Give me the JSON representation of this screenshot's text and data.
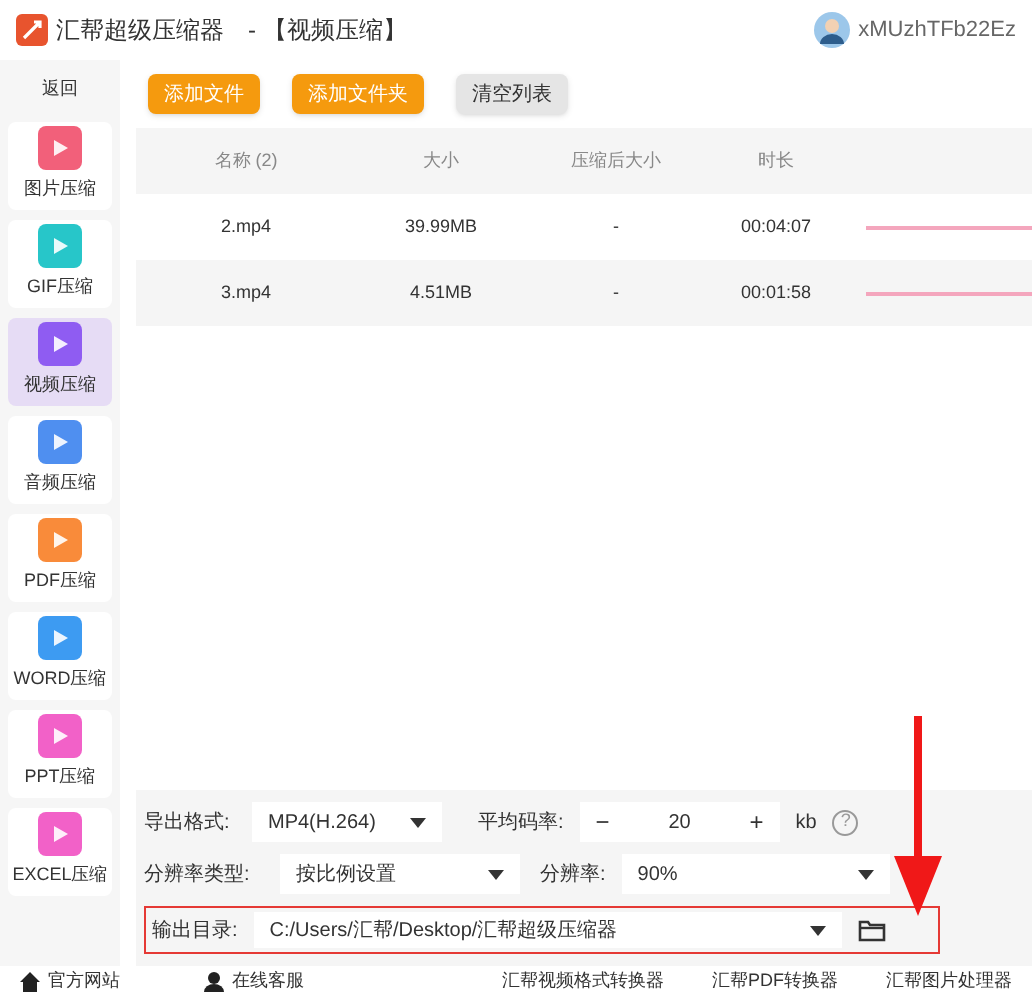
{
  "window": {
    "title": "汇帮超级压缩器",
    "subtitle": "- 【视频压缩】",
    "user": "xMUzhTFb22Ez"
  },
  "sidebar": {
    "back": "返回",
    "items": [
      {
        "label": "图片压缩",
        "color": "#f2607a",
        "selected": false
      },
      {
        "label": "GIF压缩",
        "color": "#27c6c9",
        "selected": false
      },
      {
        "label": "视频压缩",
        "color": "#8f5cf2",
        "selected": true
      },
      {
        "label": "音频压缩",
        "color": "#4f8ff0",
        "selected": false
      },
      {
        "label": "PDF压缩",
        "color": "#f98b3a",
        "selected": false
      },
      {
        "label": "WORD压缩",
        "color": "#3d9bf2",
        "selected": false
      },
      {
        "label": "PPT压缩",
        "color": "#f261c8",
        "selected": false
      },
      {
        "label": "EXCEL压缩",
        "color": "#f261c8",
        "selected": false
      }
    ]
  },
  "toolbar": [
    {
      "label": "添加文件",
      "kind": "primary"
    },
    {
      "label": "添加文件夹",
      "kind": "primary"
    },
    {
      "label": "清空列表",
      "kind": "secondary"
    }
  ],
  "table": {
    "columns": [
      "名称 (2)",
      "大小",
      "压缩后大小",
      "时长"
    ],
    "rows": [
      [
        "2.mp4",
        "39.99MB",
        "-",
        "00:04:07"
      ],
      [
        "3.mp4",
        "4.51MB",
        "-",
        "00:01:58"
      ]
    ]
  },
  "settings": {
    "format_label": "导出格式:",
    "format": "MP4(H.264)",
    "bitrate_label": "平均码率:",
    "minus": "−",
    "bitrate": "20",
    "plus": "+",
    "unit": "kb",
    "help": "?",
    "res_type_label": "分辨率类型:",
    "res_type": "按比例设置",
    "res_label": "分辨率:",
    "res": "90%",
    "output_label": "输出目录:",
    "output": "C:/Users/汇帮/Desktop/汇帮超级压缩器"
  },
  "footer": {
    "left": [
      {
        "label": "官方网站",
        "kind": "home"
      },
      {
        "label": "在线客服",
        "kind": "agent"
      }
    ],
    "right": [
      "汇帮视频格式转换器",
      "汇帮PDF转换器",
      "汇帮图片处理器"
    ]
  }
}
